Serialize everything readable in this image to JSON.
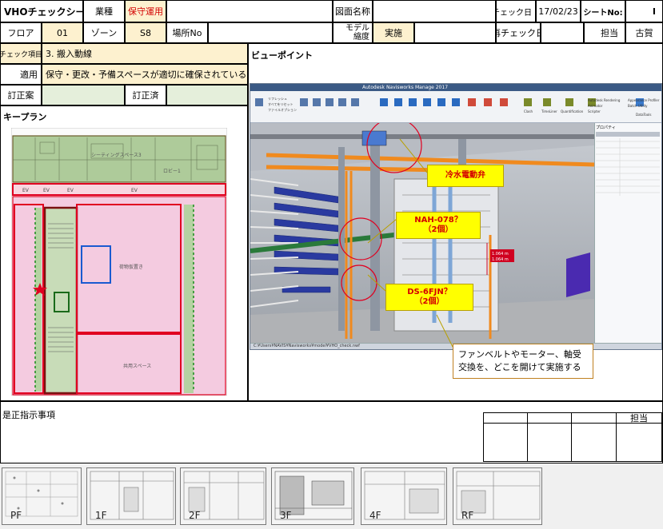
{
  "header": {
    "title": "VHOチェックシート",
    "gyomu_label": "業種",
    "gyomu_value": "保守運用",
    "zumen_label": "図面名称",
    "zumen_value": "",
    "check_date_label": "チェック日",
    "check_date_value": "17/02/23",
    "sheet_no_label": "シートNo:",
    "sheet_no_value": "I",
    "floor_label": "フロア",
    "floor_value": "01",
    "zone_label": "ゾーン",
    "zone_value": "S8",
    "place_label": "場所No",
    "place_value": "",
    "model_label_1": "モデル",
    "model_label_2": "縮度",
    "model_value": "実施",
    "recheck_label": "再チェック日",
    "recheck_value": "",
    "tanto_label": "担当",
    "tanto_value": "古賀"
  },
  "check": {
    "item_label": "チェック項目",
    "item_value": "3. 搬入動線",
    "apply_label": "適用",
    "apply_value": "保守・更改・予備スペースが適切に確保されているか",
    "teisei_an_label": "訂正案",
    "teisei_an_value": "",
    "teisei_zumi_label": "訂正済",
    "teisei_zumi_value": ""
  },
  "keyplan": {
    "title": "キープラン",
    "room_label_1": "シーティングスペース3",
    "room_label_2": "ロビー1",
    "room_label_3": "荷物仮置き",
    "room_label_4": "共用スペース"
  },
  "viewpoint": {
    "title": "ビューポイント",
    "app_title": "Autodesk Navisworks Manage 2017",
    "ribbon_items": [
      "リフレッシュ",
      "すべてをリセット",
      "ファイルオプション",
      "選択",
      "保存",
      "選択ツリー",
      "クラッシュ",
      "Clash Detective",
      "TimeLiner",
      "Quantification",
      "Autodesk Rendering",
      "Animator",
      "Scripter",
      "Appearance Profiler",
      "Batch Utility",
      "DataTools"
    ],
    "measure_1": "1.064 m",
    "measure_2": "1.064 m",
    "status_path": "C:¥Users¥NAVIS¥Navisworks¥model¥VHO_check.nwf",
    "props_title": "プロパティ"
  },
  "callouts": {
    "c1": "冷水電動弁",
    "c2_line1": "NAH-078？",
    "c2_line2": "（2個）",
    "c3_line1": "DS-6FJN？",
    "c3_line2": "（2個）",
    "note_line1": "ファンベルトやモーター、軸受",
    "note_line2": "交換を、どこを開けて実施する"
  },
  "instructions": {
    "label": "是正指示事項",
    "tanto_label": "担当"
  },
  "thumbnails": [
    "PF",
    "1F",
    "2F",
    "3F",
    "4F",
    "RF"
  ],
  "colors": {
    "yellow_cell": "#fdf1cf",
    "green_cell": "#e5efdb",
    "red_text": "#d40000",
    "callout_yellow": "#ffff00",
    "orange_pipe": "#f08a1e"
  }
}
